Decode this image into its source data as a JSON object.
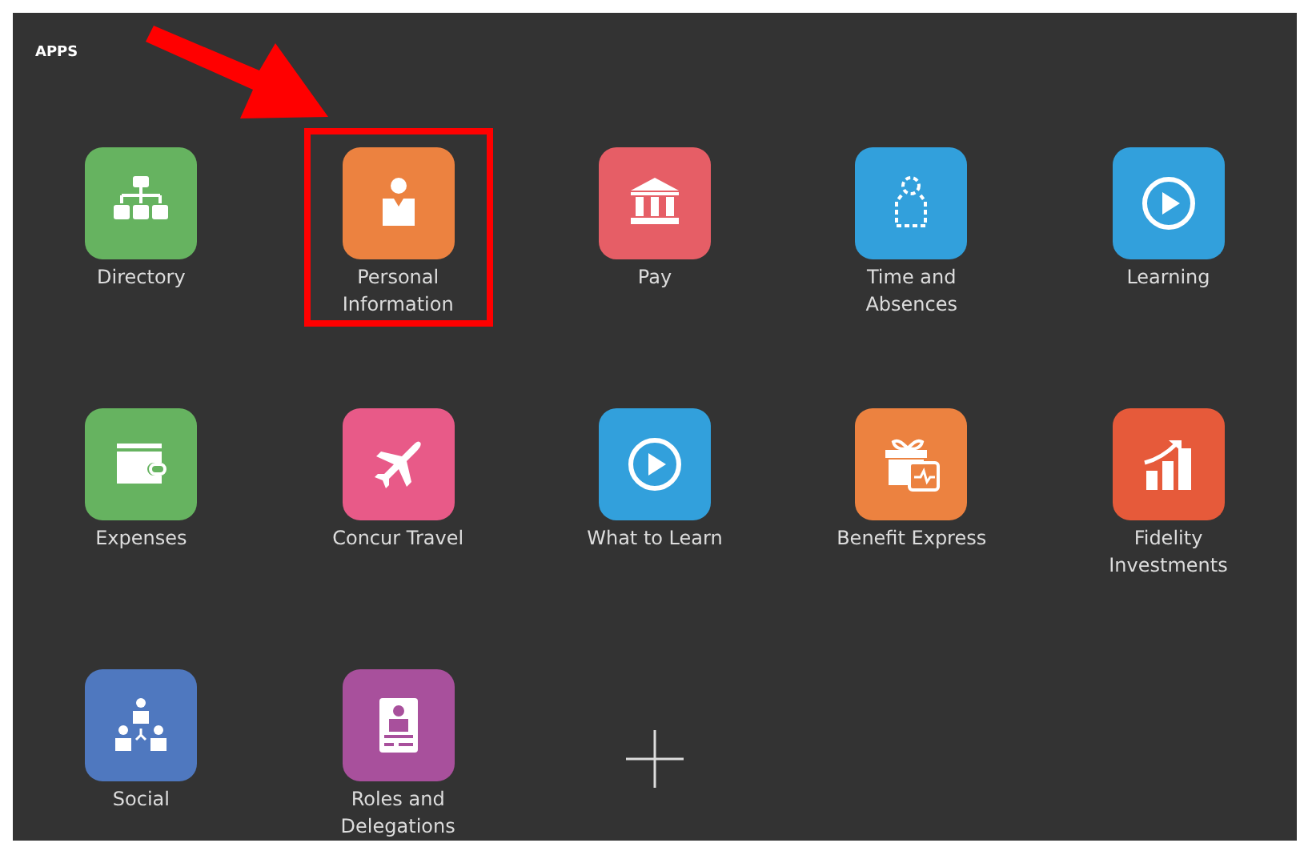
{
  "header": {
    "title": "APPS"
  },
  "apps": [
    {
      "kind": "app",
      "label": "Directory",
      "color": "#66b360",
      "highlighted": false
    },
    {
      "kind": "app",
      "label": "Personal Information",
      "color": "#ec8240",
      "highlighted": true
    },
    {
      "kind": "app",
      "label": "Pay",
      "color": "#e65e66",
      "highlighted": false
    },
    {
      "kind": "app",
      "label": "Time and Absences",
      "color": "#32a0dc",
      "highlighted": false
    },
    {
      "kind": "app",
      "label": "Learning",
      "color": "#32a0dc",
      "highlighted": false
    },
    {
      "kind": "app",
      "label": "Expenses",
      "color": "#66b360",
      "highlighted": false
    },
    {
      "kind": "app",
      "label": "Concur Travel",
      "color": "#e85a88",
      "highlighted": false
    },
    {
      "kind": "app",
      "label": "What to Learn",
      "color": "#32a0dc",
      "highlighted": false
    },
    {
      "kind": "app",
      "label": "Benefit Express",
      "color": "#ec8240",
      "highlighted": false
    },
    {
      "kind": "app",
      "label": "Fidelity Investments",
      "color": "#e65a3a",
      "highlighted": false
    },
    {
      "kind": "app",
      "label": "Social",
      "color": "#4f78bf",
      "highlighted": false
    },
    {
      "kind": "app",
      "label": "Roles and Delegations",
      "color": "#a8509c",
      "highlighted": false
    },
    {
      "kind": "add"
    }
  ]
}
